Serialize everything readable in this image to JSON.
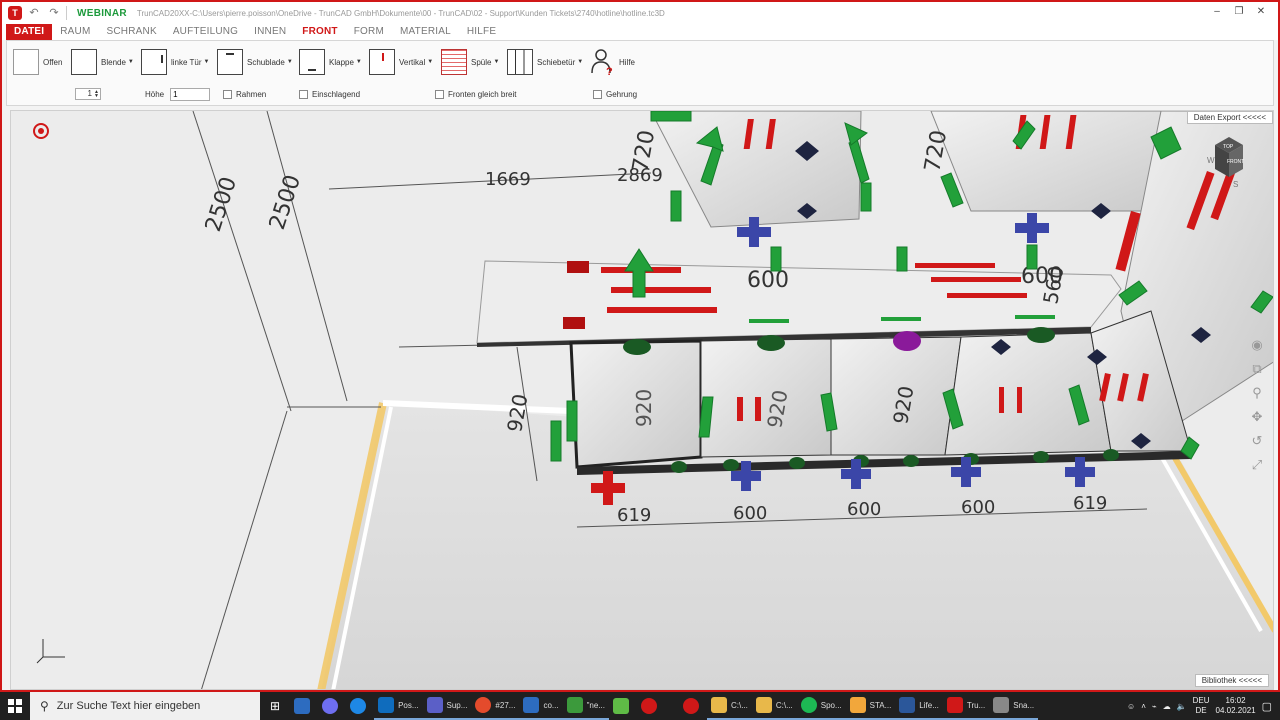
{
  "titlebar": {
    "brand": "WEBINAR",
    "path": "TrunCAD20XX-C:\\Users\\pierre.poisson\\OneDrive - TrunCAD GmbH\\Dokumente\\00 - TrunCAD\\02 - Support\\Kunden Tickets\\2740\\hotline\\hotline.tc3D",
    "controls": [
      "–",
      "❐",
      "✕"
    ]
  },
  "ribbon_tabs": [
    {
      "label": "DATEI",
      "kind": "file"
    },
    {
      "label": "RAUM",
      "kind": "normal"
    },
    {
      "label": "SCHRANK",
      "kind": "normal"
    },
    {
      "label": "AUFTEILUNG",
      "kind": "normal"
    },
    {
      "label": "INNEN",
      "kind": "normal"
    },
    {
      "label": "FRONT",
      "kind": "active"
    },
    {
      "label": "FORM",
      "kind": "normal"
    },
    {
      "label": "MATERIAL",
      "kind": "normal"
    },
    {
      "label": "HILFE",
      "kind": "normal"
    }
  ],
  "ribbon": {
    "buttons": {
      "offen": "Offen",
      "blende": "Blende",
      "linke_tuer": "linke Tür",
      "schublade": "Schublade",
      "klappe": "Klappe",
      "vertikal": "Vertikal",
      "spuele": "Spüle",
      "schiebetuer": "Schiebetür",
      "hilfe": "Hilfe"
    },
    "row2": {
      "count_value": "1",
      "hoehe_label": "Höhe",
      "hoehe_value": "1",
      "rahmen": "Rahmen",
      "einschlagend": "Einschlagend",
      "fronten_gleich_breit": "Fronten gleich breit",
      "gehrung": "Gehrung"
    }
  },
  "viewport": {
    "data_export": "Daten Export <<<<<",
    "library": "Bibliothek <<<<<",
    "viewcube": {
      "top": "TOP",
      "front": "FRONT",
      "w": "W",
      "s": "S"
    },
    "dimensions": {
      "height_a": "2500",
      "height_b": "2500",
      "width_top": "1669",
      "width_top_b": "2869",
      "upper_height": "720",
      "upper_height_b": "720",
      "counter_depth_a": "600",
      "counter_depth_b": "600",
      "counter_depth_c": "560",
      "base_height_a": "920",
      "base_height_b": "920",
      "base_height_c": "920",
      "base_height_d": "920",
      "bottom": [
        "619",
        "600",
        "600",
        "600",
        "619"
      ]
    }
  },
  "taskbar": {
    "search_placeholder": "Zur Suche Text hier eingeben",
    "apps": [
      {
        "label": "",
        "color": "#2d6cc0"
      },
      {
        "label": "",
        "color": "#6e6ef0"
      },
      {
        "label": "",
        "color": "#1e88e5"
      },
      {
        "label": "Pos...",
        "color": "#0f6cbd"
      },
      {
        "label": "Sup...",
        "color": "#5b5fc7"
      },
      {
        "label": "#27...",
        "color": "#e44b2c"
      },
      {
        "label": "co...",
        "color": "#2d6cc0"
      },
      {
        "label": "\"ne...",
        "color": "#3c9a3c"
      },
      {
        "label": "",
        "color": "#5fbb46"
      },
      {
        "label": "",
        "color": "#d01818"
      },
      {
        "label": "",
        "color": "#d01818"
      },
      {
        "label": "C:\\...",
        "color": "#e8b84a"
      },
      {
        "label": "C:\\...",
        "color": "#e8b84a"
      },
      {
        "label": "Spo...",
        "color": "#1db954"
      },
      {
        "label": "STA...",
        "color": "#f2a73b"
      },
      {
        "label": "Life...",
        "color": "#2b579a"
      },
      {
        "label": "Tru...",
        "color": "#d01818"
      },
      {
        "label": "Sna...",
        "color": "#888888"
      }
    ],
    "lang": "DEU",
    "lang_sub": "DE",
    "time": "16:02",
    "date": "04.02.2021"
  },
  "colors": {
    "accent": "#d01818",
    "brand": "#1d9a3c",
    "arrow": "#22a03a",
    "blue_cross": "#3b46a8",
    "floor_edge": "#f2c96a"
  }
}
